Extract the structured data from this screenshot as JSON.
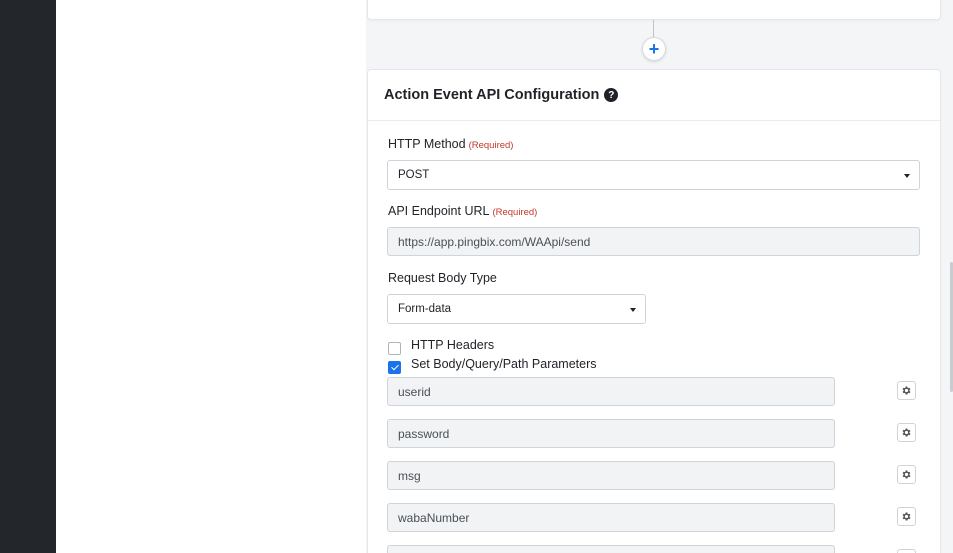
{
  "card": {
    "title": "Action Event API Configuration"
  },
  "http_method": {
    "label": "HTTP Method",
    "required": "(Required)",
    "value": "POST"
  },
  "api_endpoint": {
    "label": "API Endpoint URL",
    "required": "(Required)",
    "value": "https://app.pingbix.com/WAApi/send"
  },
  "request_body_type": {
    "label": "Request Body Type",
    "value": "Form-data"
  },
  "options": {
    "http_headers": {
      "label": "HTTP Headers",
      "checked": false
    },
    "set_params": {
      "label": "Set Body/Query/Path Parameters",
      "checked": true
    }
  },
  "params": [
    {
      "name": "userid"
    },
    {
      "name": "password"
    },
    {
      "name": "msg"
    },
    {
      "name": "wabaNumber"
    },
    {
      "name": ""
    }
  ],
  "icons": {
    "add": "plus-icon",
    "help": "question-circle-icon",
    "settings": "gear-icon",
    "dropdown": "caret-down-icon"
  },
  "colors": {
    "accent": "#1a73e8",
    "required": "#c0392b",
    "sidebar": "#23272b"
  }
}
